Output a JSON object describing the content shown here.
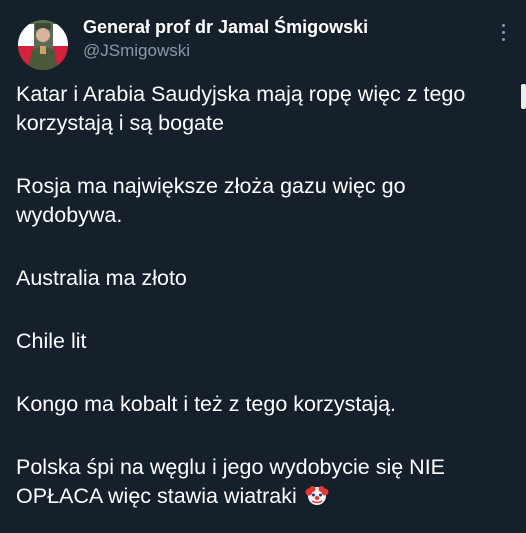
{
  "author": {
    "display_name": "Generał prof dr Jamal Śmigowski",
    "handle": "@JSmigowski"
  },
  "icons": {
    "avatar": "avatar-photo-with-polish-flag",
    "more": "more-options-icon",
    "emoji": "clown-face-icon"
  },
  "tweet": {
    "p1": "Katar i Arabia Saudyjska mają ropę więc z tego korzystają i są bogate",
    "p2": "Rosja ma największe złoża gazu więc go wydobywa.",
    "p3": "Australia ma złoto",
    "p4": "Chile lit",
    "p5": "Kongo ma kobalt i też z tego korzystają.",
    "p6": "Polska śpi na węglu i jego wydobycie się NIE OPŁACA więc stawia wiatraki"
  },
  "colors": {
    "background": "#15202b",
    "text": "#ffffff",
    "secondary_text": "#8b98a5"
  }
}
